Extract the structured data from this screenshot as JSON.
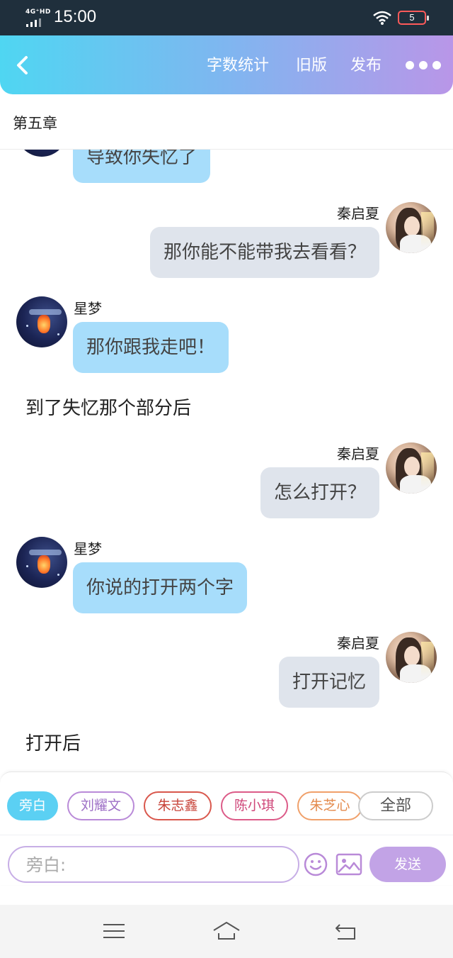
{
  "status_bar": {
    "network": "4G⁺HD",
    "time": "15:00",
    "battery": "5"
  },
  "nav": {
    "links": [
      "字数统计",
      "旧版",
      "发布"
    ]
  },
  "chapter": {
    "title": "第五章"
  },
  "chat": {
    "partial_message": "导致你失忆了",
    "messages": [
      {
        "speaker": "秦启夏",
        "text": "那你能不能带我去看看？"
      },
      {
        "speaker": "星梦",
        "text": "那你跟我走吧！"
      },
      {
        "narration": "到了失忆那个部分后"
      },
      {
        "speaker": "秦启夏",
        "text": "怎么打开？"
      },
      {
        "speaker": "星梦",
        "text": "你说的打开两个字"
      },
      {
        "speaker": "秦启夏",
        "text": "打开记忆"
      },
      {
        "narration": "打开后"
      }
    ]
  },
  "composer": {
    "characters": [
      {
        "label": "旁白",
        "active": true,
        "color": "#5bd0f3"
      },
      {
        "label": "刘耀文",
        "color": "#b98ad8"
      },
      {
        "label": "朱志鑫",
        "color": "#d9574c"
      },
      {
        "label": "陈小琪",
        "color": "#dc5b88"
      },
      {
        "label": "朱芝心",
        "color": "#f0a06a"
      },
      {
        "label": "全部",
        "color": "#cccccc"
      }
    ],
    "input_placeholder": "旁白:",
    "send_label": "发送"
  }
}
